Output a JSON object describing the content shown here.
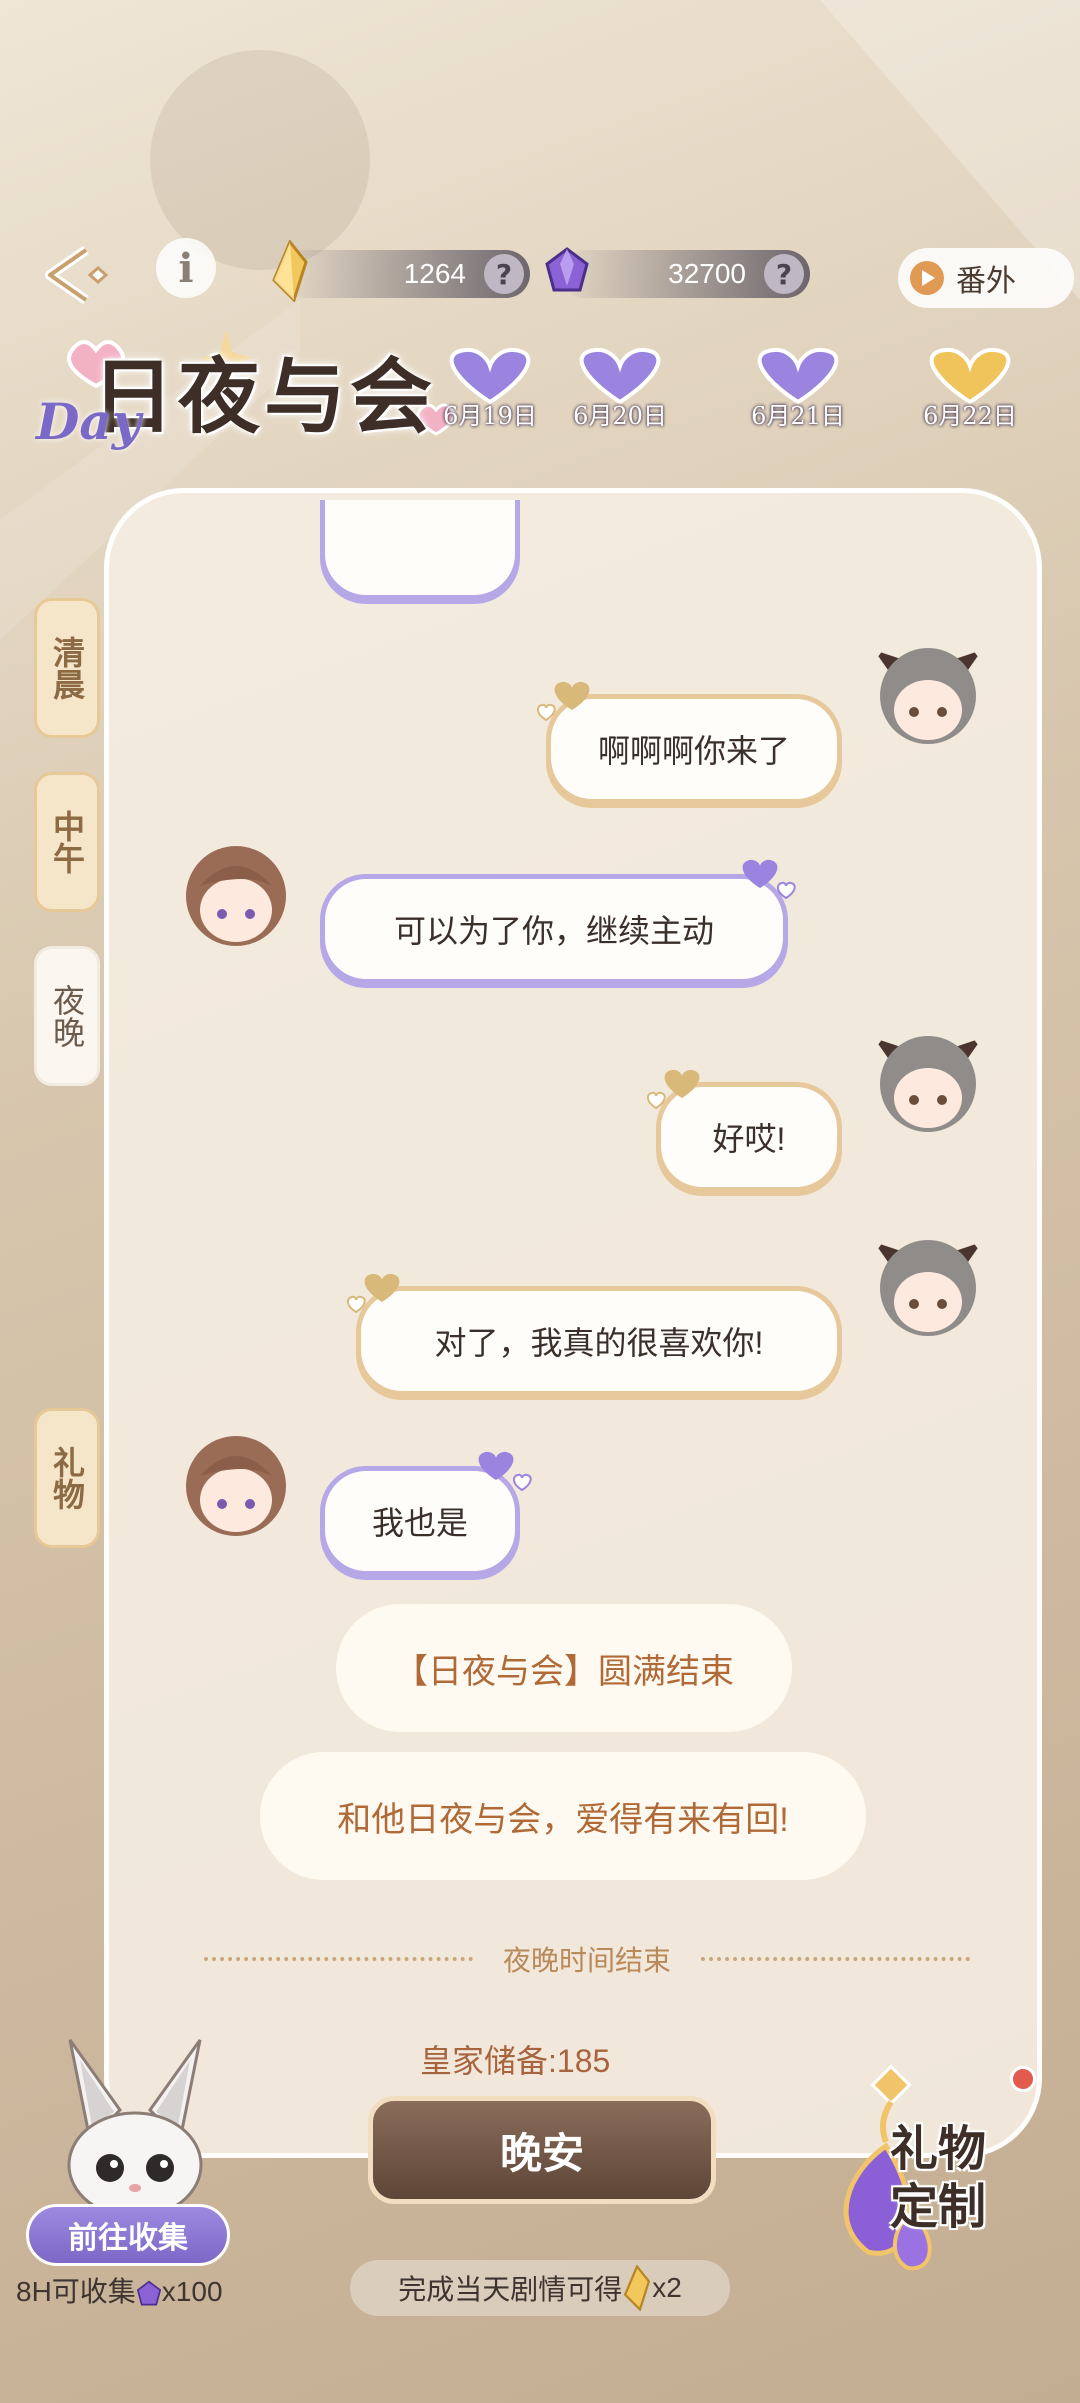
{
  "header": {
    "currency_gold": "1264",
    "currency_gem": "32700",
    "help_glyph": "?",
    "info_glyph": "i",
    "extra_label": "番外"
  },
  "title": {
    "main": "日夜与会",
    "tag": "Day"
  },
  "dates": [
    {
      "label": "6月19日",
      "heart": "purple"
    },
    {
      "label": "6月20日",
      "heart": "purple"
    },
    {
      "label": "6月21日",
      "heart": "purple"
    },
    {
      "label": "6月22日",
      "heart": "gold"
    }
  ],
  "tabs": [
    {
      "label": "清晨"
    },
    {
      "label": "中午"
    },
    {
      "label": "夜晚"
    },
    {
      "label": "礼物"
    }
  ],
  "messages": [
    {
      "from": "me",
      "text": "啊啊啊你来了"
    },
    {
      "from": "him",
      "text": "可以为了你，继续主动"
    },
    {
      "from": "me",
      "text": "好哎!"
    },
    {
      "from": "me",
      "text": "对了，我真的很喜欢你!"
    },
    {
      "from": "him",
      "text": "我也是"
    }
  ],
  "system": [
    {
      "text": "【日夜与会】圆满结束"
    },
    {
      "text": "和他日夜与会，爱得有来有回!"
    }
  ],
  "divider_text": "夜晚时间结束",
  "reserve_text": "皇家储备:185",
  "good_night_label": "晚安",
  "reward_hint": "完成当天剧情可得",
  "reward_count": "x2",
  "collect": {
    "button": "前往收集",
    "sub_prefix": "8H可收集",
    "sub_count": "x100"
  },
  "gift_custom": {
    "line1": "礼物",
    "line2": "定制"
  },
  "colors": {
    "accent_purple": "#7c68c7",
    "accent_gold": "#e6c89a",
    "system_text": "#b06a37"
  },
  "icons": [
    "back-arrow-icon",
    "info-icon",
    "gold-crystal-icon",
    "purple-gem-icon",
    "help-icon",
    "play-icon",
    "heart-icon",
    "rabbit-mascot-icon",
    "earring-gift-icon"
  ]
}
